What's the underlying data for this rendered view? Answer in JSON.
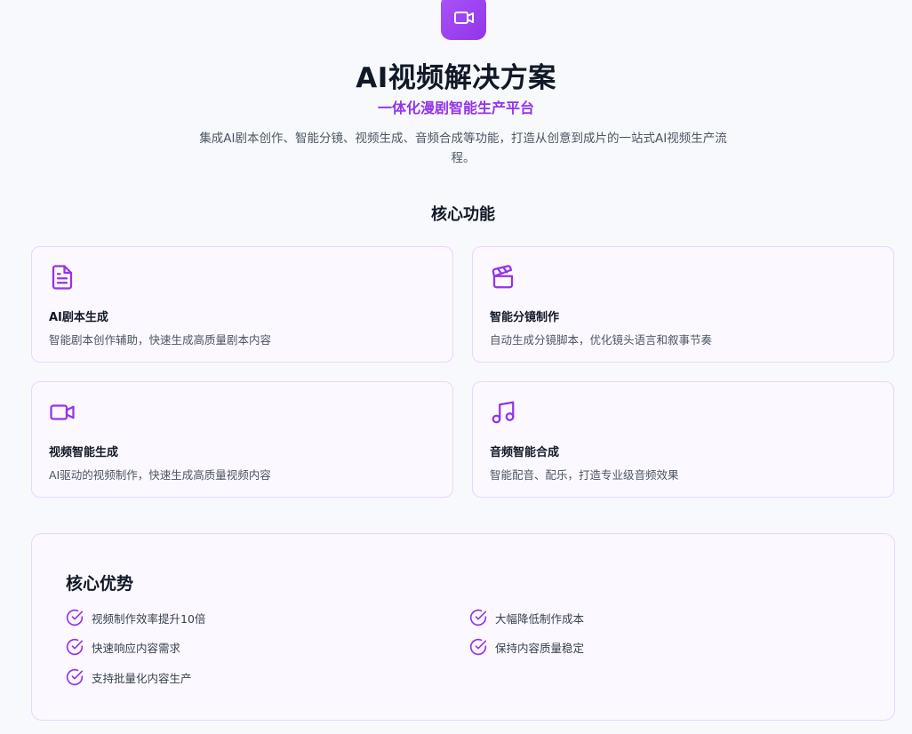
{
  "hero": {
    "icon": "video-camera-icon",
    "title": "AI视频解决方案",
    "subtitle": "一体化漫剧智能生产平台",
    "description": "集成AI剧本创作、智能分镜、视频生成、音频合成等功能，打造从创意到成片的一站式AI视频生产流程。"
  },
  "features": {
    "title": "核心功能",
    "items": [
      {
        "icon": "document-icon",
        "title": "AI剧本生成",
        "desc": "智能剧本创作辅助，快速生成高质量剧本内容"
      },
      {
        "icon": "clapperboard-icon",
        "title": "智能分镜制作",
        "desc": "自动生成分镜脚本，优化镜头语言和叙事节奏"
      },
      {
        "icon": "video-camera-icon",
        "title": "视频智能生成",
        "desc": "AI驱动的视频制作，快速生成高质量视频内容"
      },
      {
        "icon": "music-note-icon",
        "title": "音频智能合成",
        "desc": "智能配音、配乐，打造专业级音频效果"
      }
    ]
  },
  "advantages": {
    "title": "核心优势",
    "items": [
      "视频制作效率提升10倍",
      "大幅降低制作成本",
      "快速响应内容需求",
      "保持内容质量稳定",
      "支持批量化内容生产"
    ]
  },
  "colors": {
    "accent": "#9333ea",
    "card_border": "#e9d5ff",
    "card_bg": "#fcf8ff"
  }
}
